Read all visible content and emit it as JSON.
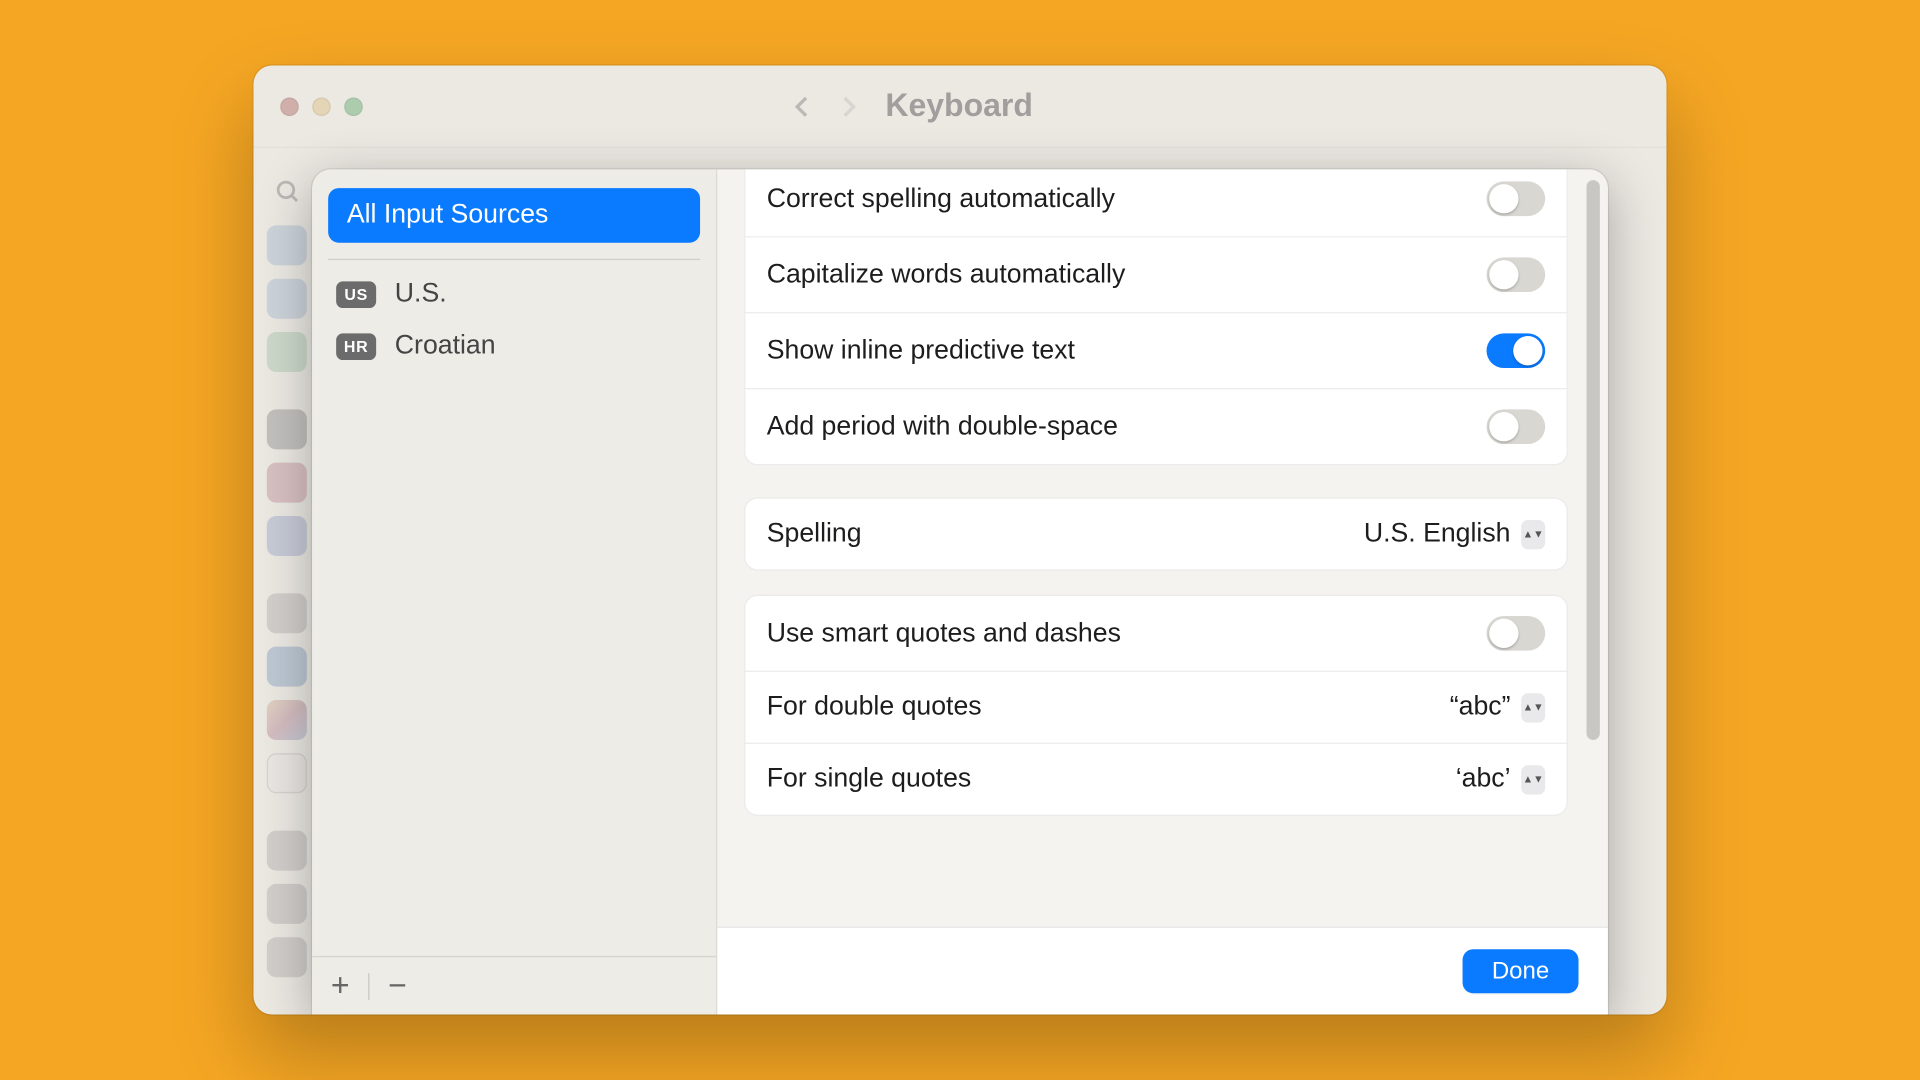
{
  "window": {
    "title": "Keyboard"
  },
  "sidebar": {
    "all_label": "All Input Sources",
    "sources": [
      {
        "code": "US",
        "name": "U.S."
      },
      {
        "code": "HR",
        "name": "Croatian"
      }
    ]
  },
  "settings": {
    "correct_spelling": {
      "label": "Correct spelling automatically",
      "on": false
    },
    "capitalize": {
      "label": "Capitalize words automatically",
      "on": false
    },
    "predictive": {
      "label": "Show inline predictive text",
      "on": true
    },
    "double_space": {
      "label": "Add period with double-space",
      "on": false
    },
    "spelling": {
      "label": "Spelling",
      "value": "U.S. English"
    },
    "smart_quotes": {
      "label": "Use smart quotes and dashes",
      "on": false
    },
    "double_quotes": {
      "label": "For double quotes",
      "value": "“abc”"
    },
    "single_quotes": {
      "label": "For single quotes",
      "value": "‘abc’"
    }
  },
  "buttons": {
    "done": "Done"
  }
}
